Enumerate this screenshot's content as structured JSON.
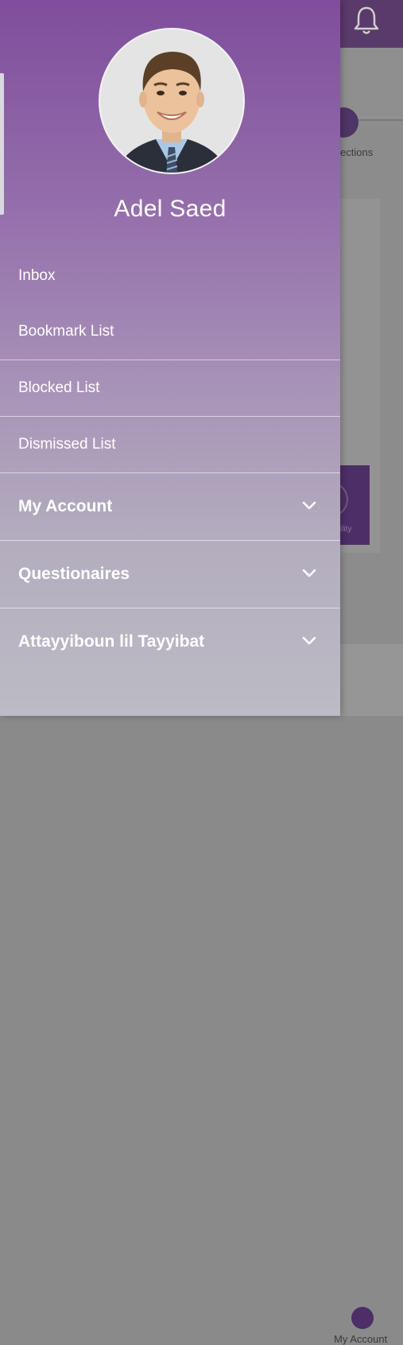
{
  "background": {
    "connections_tab_label": "ections",
    "tile_label": "ility",
    "bottom_nav_account_label": "My Account"
  },
  "drawer": {
    "user_name": "Adel Saed",
    "menu": [
      {
        "label": "Inbox"
      },
      {
        "label": "Bookmark List"
      },
      {
        "label": "Blocked List"
      },
      {
        "label": "Dismissed List"
      }
    ],
    "sections": [
      {
        "label": "My Account",
        "icon": "chevron-down-icon"
      },
      {
        "label": "Questionaires",
        "icon": "chevron-down-icon"
      },
      {
        "label": "Attayyiboun lil Tayyibat",
        "icon": "chevron-down-icon"
      }
    ]
  },
  "colors": {
    "drawer_top": "#7f4d9c",
    "drawer_bottom": "#bcbcc4",
    "accent_purple": "#4e2e66"
  }
}
